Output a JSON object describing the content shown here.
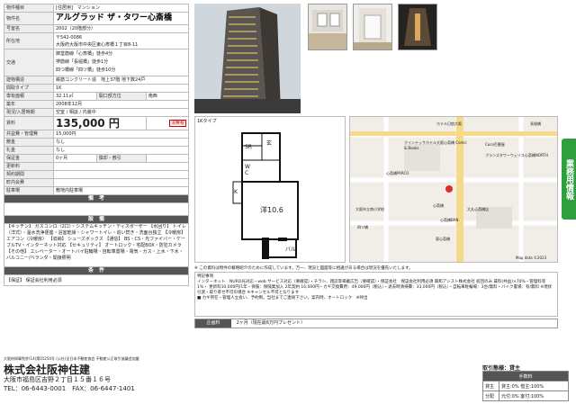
{
  "spec": {
    "type_label": "物件種目",
    "type_value": "[住居用]　マンション",
    "name_label": "物件名",
    "name_value": "アルグラッド ザ・タワー心斎橋",
    "room_label": "号室名",
    "room_value": "2002（20階部分）",
    "address_label": "所在地",
    "postal": "〒542-0086",
    "address_value": "大阪府大阪市中央区東心斎橋１丁目8-11",
    "transport_label": "交通",
    "transport_lines": [
      "御堂筋線「心斎橋」徒歩4分",
      "堺筋線「長堀橋」徒歩1分",
      "四つ橋線「四ツ橋」徒歩10分"
    ],
    "structure_label": "建物構造",
    "structure_value": "鉄筋コンクリート造　地上37階 地下数24戸",
    "layout_label": "間取タイプ",
    "layout_value": "1K",
    "area_label": "専有面積",
    "area_value": "32.11㎡",
    "window_label": "開口部方位",
    "window_value": "南西",
    "built_label": "築年",
    "built_value": "2008年12月",
    "status_label": "現況/入居時期",
    "status_value": "空室 / 相談 / 内装中",
    "rent_label": "賃料",
    "rent_value": "135,000 円",
    "rent_badge": "消費税",
    "mgmt_label": "共益費・管理費",
    "mgmt_value": "15,000円",
    "deposit_label": "敷金",
    "deposit_value": "なし",
    "keymoney_label": "礼金",
    "keymoney_value": "なし",
    "guarantee_label": "保証金",
    "guarantee_value": "0ヶ月",
    "amort_label": "償却・敷引",
    "renewal_label": "更新料",
    "contract_label": "契約期間",
    "other_label": "町内会費",
    "parking_label": "駐車場",
    "parking_value": "敷地内駐車場",
    "remarks_title": "備　考",
    "facilities_title": "設　備",
    "facilities_text": "【キッチン】 ガスコンロ（2口）・システムキッチン・ディスポーザー 【水回り】 トイレ（洋式）・温水洗浄便座・浴室乾燥・シャワートイレ・追い焚き・洗面台独立 【冷暖房】 エアコン（冷暖房） 【収納】 シューズボックス 【通信】 BS・CS・光ファイバー・ケーブルTV・インターネット対応 【セキュリティ】 オートロック・宅配BOX・防犯カメラ 【その他】 エレベーター・オートバイ駐輪場・自転車置場・電気・ガス・上水・下水・バルコニー/ベランダ・間接照明",
    "conditions_title": "条　件",
    "conditions_text": "【保証】 保証会社利用必須"
  },
  "floorplan": {
    "label": "1Kタイプ",
    "room_size": "洋10.6",
    "sr": "SR",
    "genkan": "玄",
    "wc": "W C",
    "kitchen": "K",
    "balcony": "バル"
  },
  "map": {
    "labels": [
      "ホテル日航大阪",
      "長堀橋",
      "クインテッサホテル大阪心斎橋 Comic & Books",
      "Coco壱番屋",
      "ブランズタワーウェリス心斎橋NORTH",
      "心斎橋",
      "大丸心斎橋店",
      "四ツ橋",
      "東心斎橋",
      "心斎橋PARCO",
      "大阪市立南小学校",
      "心斎橋BAN",
      "Map data ©2023"
    ]
  },
  "note_small": "※ この資料は物件の概略紹介のために作成しています。万一、現況と図面等に相違がある場合は現況を優先いたします。",
  "special": {
    "title": "特記事項",
    "text": "インターネット　NURO光対応・web サービス対応（要確認）・チラシ、雑誌等掲載広告（要確認）・保証会社　保証会社利用必須 興和アシスト株式会社 初回のみ 賃料(共益)×70%・管理料等1%・ 更新料10,000円/1年・保険：保険業加入 2年契約 16,000円・カギ交換費用：49,000円（税込）・退去時清掃費：33,000円（税込）・自転車駐輪場：3台/無料・バイク置場：有/無料 ※現状引渡・取り寄せ不可の場合 ※キャンセル不可となります",
    "extra": "■ カギ所在・管理人立会い、予約制。当社までご連絡下さい。案内時、オートロック　※呼出"
  },
  "campaign": {
    "label": "企画料",
    "value": "2ヶ月（現在最6万円プレゼント）"
  },
  "license": "大阪府知事免許(14)第01254号 (公社)全日本不動産協会 不動産公正取引協議会加盟",
  "company": {
    "name": "株式会社阪神住建",
    "address": "大阪市福島区吉野２丁目１５番１６号",
    "tel": "TEL：06-6443-0001　FAX：06-6447-1401"
  },
  "transaction": {
    "title": "取引態様：貸主",
    "fee_header": "手数料",
    "rows": [
      {
        "label": "貸主",
        "value": "貸主:0%  借主:100%"
      },
      {
        "label": "分配",
        "value": "元付:0%  客付:100%"
      }
    ]
  },
  "side_tab": "業務用情報"
}
